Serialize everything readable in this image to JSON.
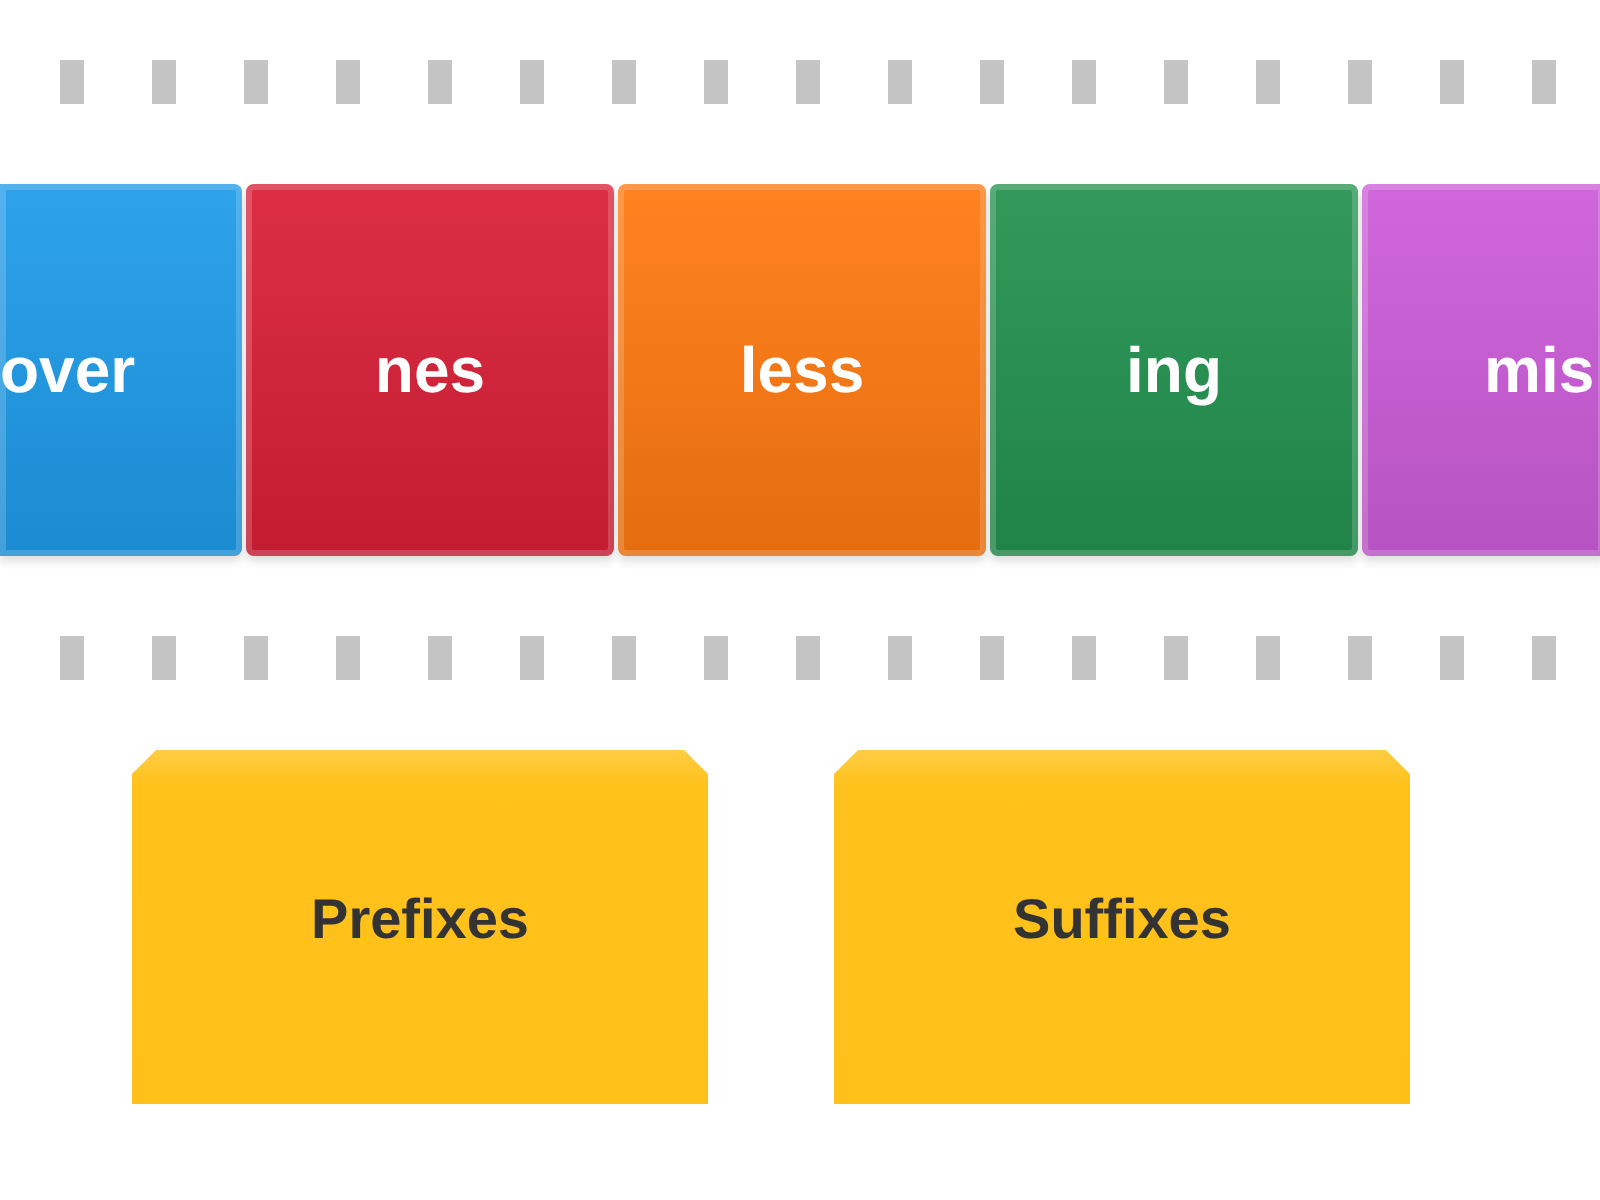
{
  "tiles": [
    {
      "text": "over",
      "color": "#1e9be9"
    },
    {
      "text": "nes",
      "color": "#d91f36"
    },
    {
      "text": "less",
      "color": "#ff7910"
    },
    {
      "text": "ing",
      "color": "#23924f"
    },
    {
      "text": "mis",
      "color": "#cc5cd9"
    }
  ],
  "groups": [
    {
      "label": "Prefixes"
    },
    {
      "label": "Suffixes"
    }
  ]
}
